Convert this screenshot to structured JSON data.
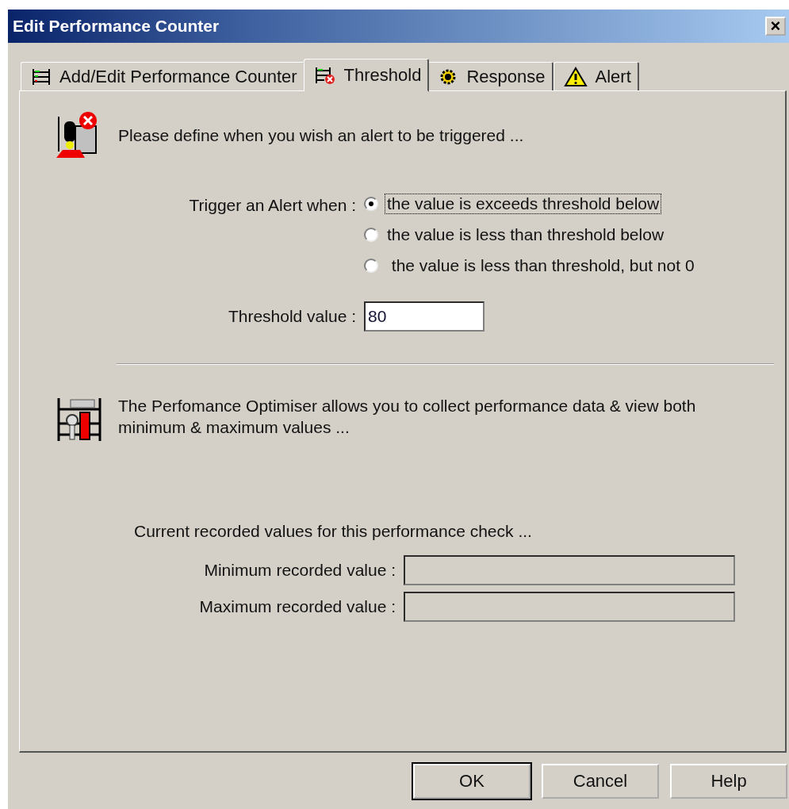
{
  "window": {
    "title": "Edit Performance Counter",
    "close": "×"
  },
  "tabs": [
    {
      "label": "Add/Edit Performance Counter",
      "selected": false,
      "kind": "chart"
    },
    {
      "label": "Threshold",
      "selected": true,
      "kind": "threshold"
    },
    {
      "label": "Response",
      "selected": false,
      "kind": "gear"
    },
    {
      "label": "Alert",
      "selected": false,
      "kind": "warning"
    }
  ],
  "intro": "Please define when you wish an alert to be triggered ...",
  "trigger": {
    "label": "Trigger an Alert when :",
    "options": [
      {
        "label": "the value is exceeds threshold below",
        "selected": true,
        "focused": true
      },
      {
        "label": "the value is less than threshold below",
        "selected": false,
        "focused": false
      },
      {
        "label": " the value is less than threshold, but not 0",
        "selected": false,
        "focused": false
      }
    ]
  },
  "threshold": {
    "label": "Threshold value :",
    "value": "80"
  },
  "optimiser_text": "The Perfomance Optimiser allows you to collect performance data & view both minimum & maximum values ...",
  "recorded_heading": "Current recorded values for this performance check ...",
  "recorded": [
    {
      "label": "Minimum recorded value :"
    },
    {
      "label": "Maximum recorded value :"
    }
  ],
  "buttons": [
    {
      "label": "OK",
      "default": true
    },
    {
      "label": "Cancel",
      "default": false
    },
    {
      "label": "Help",
      "default": false
    }
  ]
}
